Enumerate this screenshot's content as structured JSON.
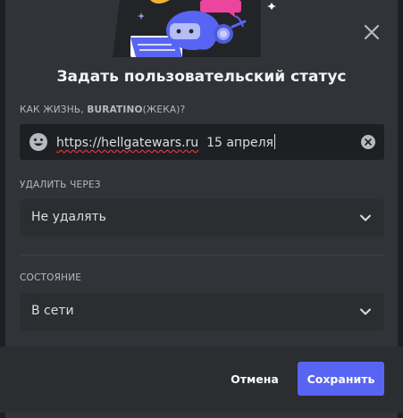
{
  "dialog": {
    "title": "Задать пользовательский статус",
    "close_icon": "close-icon"
  },
  "status_section": {
    "label_prefix": "КАК ЖИЗНЬ, ",
    "username": "BURATINO",
    "label_suffix": "(ЖЕКА)?",
    "emoji_icon": "smiley-icon",
    "value_url": "https://hellgatewars.ru",
    "value_rest": "  15 апреля",
    "clear_icon": "clear-icon"
  },
  "clear_after": {
    "label": "УДАЛИТЬ ЧЕРЕЗ",
    "selected": "Не удалять",
    "icon": "chevron-down-icon"
  },
  "presence": {
    "label": "СОСТОЯНИЕ",
    "selected": "В сети",
    "icon": "chevron-down-icon"
  },
  "footer": {
    "cancel_label": "Отмена",
    "save_label": "Сохранить"
  },
  "colors": {
    "accent": "#5865f2",
    "background": "#313338",
    "input_bg": "#1e1f22",
    "footer_bg": "#2b2d31"
  }
}
